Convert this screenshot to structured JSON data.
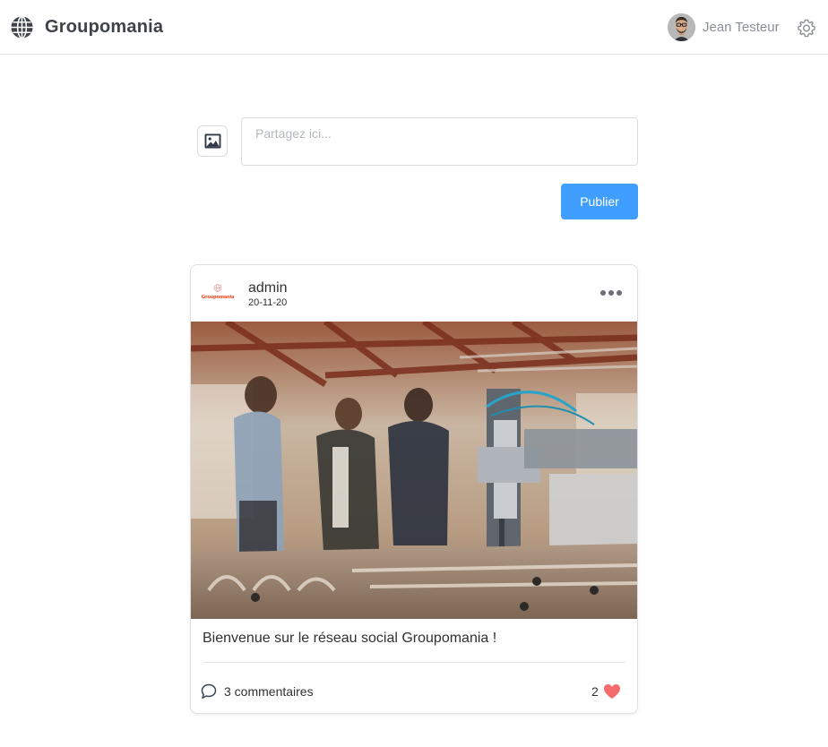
{
  "header": {
    "brand_name": "Groupomania",
    "user_name": "Jean Testeur"
  },
  "composer": {
    "placeholder": "Partagez ici...",
    "value": "",
    "publish_label": "Publier"
  },
  "post": {
    "logo_text": "Groupomania",
    "author": "admin",
    "date": "20-11-20",
    "text": "Bienvenue sur le réseau social Groupomania !",
    "comments_label": "3 commentaires",
    "likes_count": "2"
  },
  "colors": {
    "accent": "#409eff",
    "like": "#f56c6c",
    "logo": "#fd2d01"
  },
  "icons": {
    "brand": "globe-icon",
    "settings": "gear-icon",
    "upload": "image-icon",
    "menu": "more-dots-icon",
    "comment": "comment-icon",
    "like": "heart-icon"
  }
}
